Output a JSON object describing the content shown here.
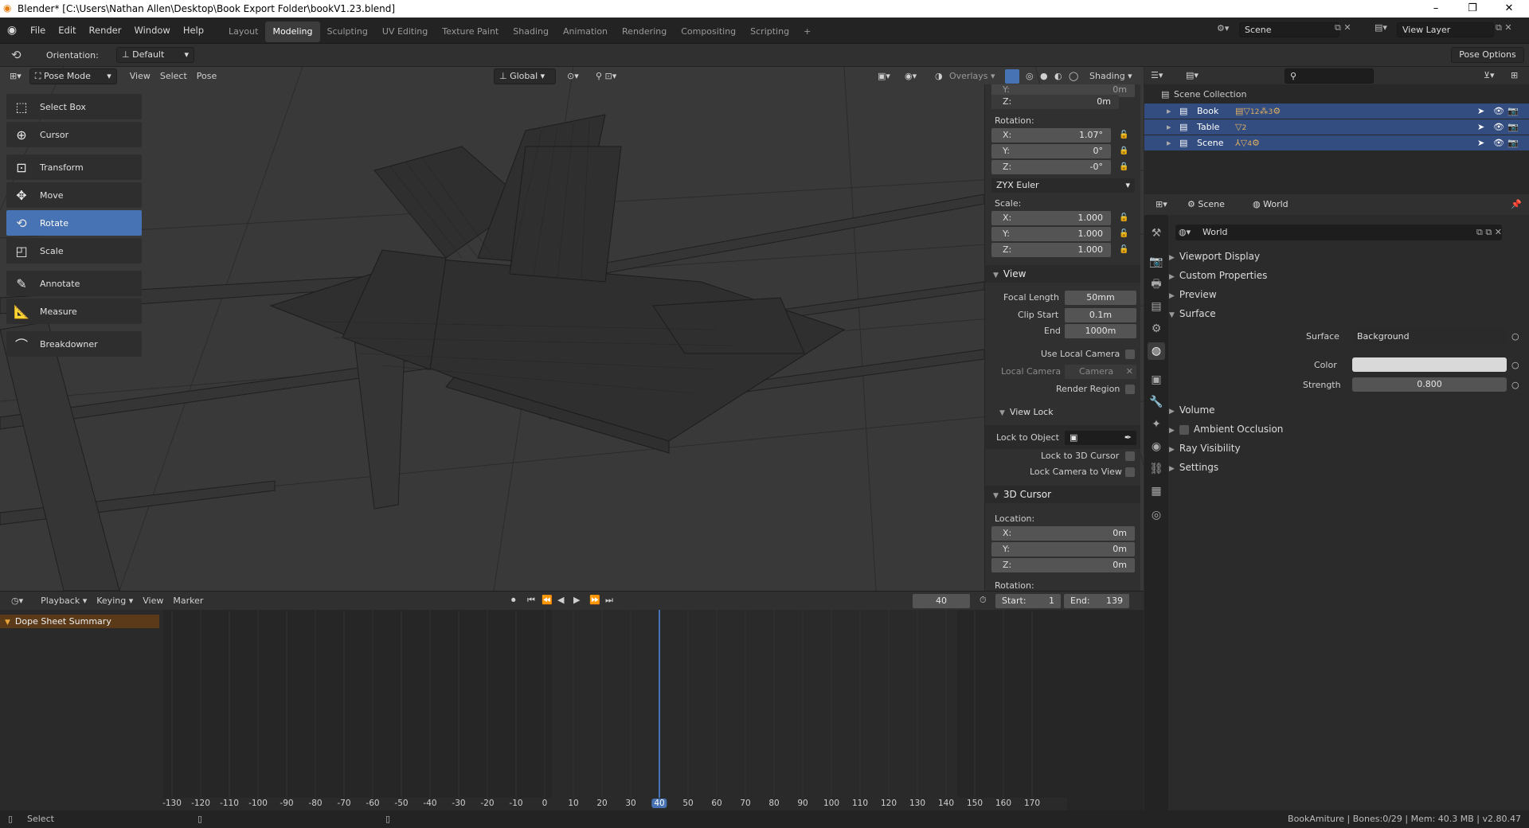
{
  "titlebar": {
    "title": "Blender* [C:\\Users\\Nathan Allen\\Desktop\\Book Export Folder\\bookV1.23.blend]"
  },
  "menu": [
    "File",
    "Edit",
    "Render",
    "Window",
    "Help"
  ],
  "workspaces": [
    "Layout",
    "Modeling",
    "Sculpting",
    "UV Editing",
    "Texture Paint",
    "Shading",
    "Animation",
    "Rendering",
    "Compositing",
    "Scripting"
  ],
  "active_workspace": "Modeling",
  "scene_field": "Scene",
  "view_layer_field": "View Layer",
  "toolhdr": {
    "orientation_label": "Orientation:",
    "orientation_value": "Default",
    "pose_options": "Pose Options"
  },
  "viewport_header": {
    "mode": "Pose Mode",
    "view": "View",
    "select": "Select",
    "pose": "Pose",
    "transform_orientation": "Global",
    "overlays": "Overlays",
    "shading": "Shading"
  },
  "tools": [
    "Select Box",
    "Cursor",
    "Transform",
    "Move",
    "Rotate",
    "Scale",
    "Annotate",
    "Measure",
    "Breakdowner"
  ],
  "active_tool": "Rotate",
  "npanel": {
    "top_y": "Y:",
    "top_y_val": "0m",
    "top_z": "Z:",
    "top_z_val": "0m",
    "rotation_label": "Rotation:",
    "rot": [
      {
        "k": "X:",
        "v": "1.07°"
      },
      {
        "k": "Y:",
        "v": "0°"
      },
      {
        "k": "Z:",
        "v": "-0°"
      }
    ],
    "rot_mode": "ZYX Euler",
    "scale_label": "Scale:",
    "scale": [
      {
        "k": "X:",
        "v": "1.000"
      },
      {
        "k": "Y:",
        "v": "1.000"
      },
      {
        "k": "Z:",
        "v": "1.000"
      }
    ],
    "view_section": "View",
    "focal_length_label": "Focal Length",
    "focal_length": "50mm",
    "clip_start_label": "Clip Start",
    "clip_start": "0.1m",
    "clip_end_label": "End",
    "clip_end": "1000m",
    "use_local_camera": "Use Local Camera",
    "local_camera_label": "Local Camera",
    "local_camera_value": "Camera",
    "render_region": "Render Region",
    "view_lock_section": "View Lock",
    "lock_to_object": "Lock to Object",
    "lock_to_cursor": "Lock to 3D Cursor",
    "lock_camera_to_view": "Lock Camera to View",
    "cursor_section": "3D Cursor",
    "location_label": "Location:",
    "cursor_loc": [
      {
        "k": "X:",
        "v": "0m"
      },
      {
        "k": "Y:",
        "v": "0m"
      },
      {
        "k": "Z:",
        "v": "0m"
      }
    ],
    "rotation_label2": "Rotation:"
  },
  "timeline": {
    "playback": "Playback",
    "keying": "Keying",
    "view": "View",
    "marker": "Marker",
    "current_frame": "40",
    "start_label": "Start:",
    "start": "1",
    "end_label": "End:",
    "end": "139",
    "summary": "Dope Sheet Summary",
    "ticks": [
      "-130",
      "-120",
      "-110",
      "-100",
      "-90",
      "-80",
      "-70",
      "-60",
      "-50",
      "-40",
      "-30",
      "-20",
      "-10",
      "0",
      "10",
      "20",
      "30",
      "40",
      "50",
      "60",
      "70",
      "80",
      "90",
      "100",
      "110",
      "120",
      "130",
      "140",
      "150",
      "160",
      "170"
    ]
  },
  "outliner": {
    "root": "Scene Collection",
    "items": [
      "Book",
      "Table",
      "Scene"
    ],
    "book_badge": "12",
    "book_badge2": "3",
    "table_badge": "2",
    "scene_badge": "4"
  },
  "properties": {
    "tab_scene": "Scene",
    "tab_world": "World",
    "world_name": "World",
    "panels": [
      "Viewport Display",
      "Custom Properties",
      "Preview",
      "Surface"
    ],
    "surface_label": "Surface",
    "surface_value": "Background",
    "color_label": "Color",
    "strength_label": "Strength",
    "strength_value": "0.800",
    "panels2": [
      "Volume",
      "Ambient Occlusion",
      "Ray Visibility",
      "Settings"
    ]
  },
  "status": {
    "left": "Select",
    "right": "BookAmiture | Bones:0/29 | Mem: 40.3 MB | v2.80.47"
  }
}
